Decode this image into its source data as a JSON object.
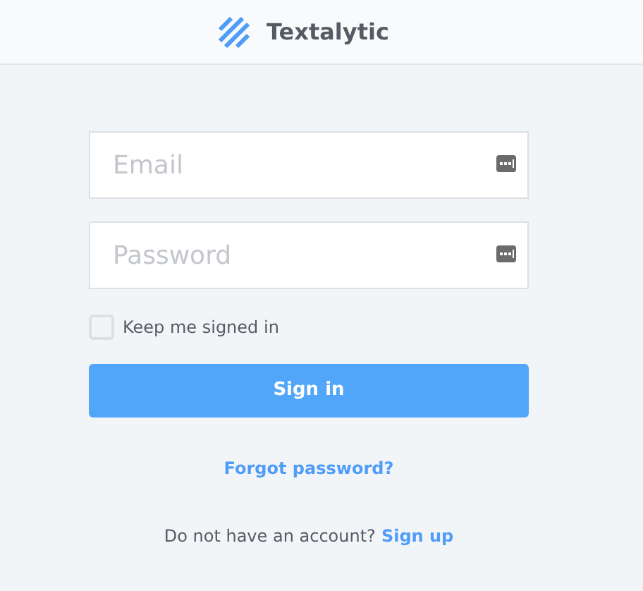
{
  "header": {
    "brand": "Textalytic"
  },
  "fields": [
    {
      "placeholder": "Email"
    },
    {
      "placeholder": "Password"
    }
  ],
  "remember": {
    "label": "Keep me signed in",
    "checked": false
  },
  "submit": "Sign in",
  "forgot": "Forgot password?",
  "signup": {
    "text": "Do not have an account?",
    "link": "Sign up"
  }
}
